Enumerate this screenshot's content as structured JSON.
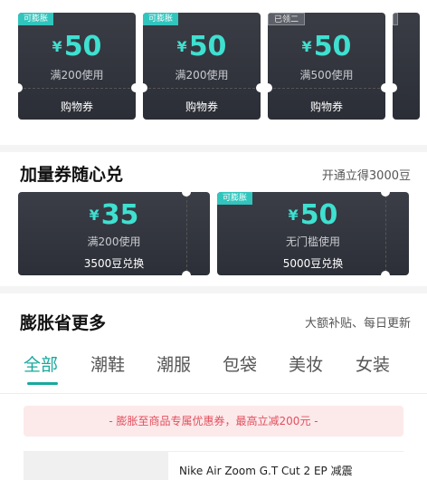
{
  "top": {
    "title": "",
    "coupons": [
      {
        "tag": "可膨胀",
        "tag_style": "teal",
        "currency": "¥",
        "amount": "50",
        "condition": "满200使用",
        "type": "购物券"
      },
      {
        "tag": "可膨胀",
        "tag_style": "teal",
        "currency": "¥",
        "amount": "50",
        "condition": "满200使用",
        "type": "购物券"
      },
      {
        "tag": "已领二",
        "tag_style": "dark",
        "currency": "¥",
        "amount": "50",
        "condition": "满500使用",
        "type": "购物券"
      }
    ]
  },
  "plus": {
    "title": "加量券随心兑",
    "right_text": "开通立得3000豆",
    "coupons": [
      {
        "tag": "",
        "currency": "¥",
        "amount": "35",
        "condition": "满200使用",
        "exchange": "3500豆兑换"
      },
      {
        "tag": "可膨胀",
        "currency": "¥",
        "amount": "50",
        "condition": "无门槛使用",
        "exchange": "5000豆兑换"
      }
    ]
  },
  "expand": {
    "title": "膨胀省更多",
    "right_text": "大额补贴、每日更新",
    "tabs": [
      "全部",
      "潮鞋",
      "潮服",
      "包袋",
      "美妆",
      "女装"
    ],
    "active_tab": "全部",
    "banner": "- 膨胀至商品专属优惠券，最高立减200元 -",
    "product_name": "Nike Air Zoom G.T Cut 2 EP 减震"
  },
  "colors": {
    "accent": "#17a99d",
    "amount": "#3fe0d0",
    "coupon_bg": "#2e3139",
    "banner_text": "#e2505e",
    "banner_bg": "#fce9ea"
  }
}
